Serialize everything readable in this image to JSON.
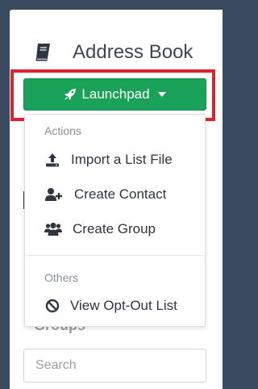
{
  "header": {
    "title": "Address Book",
    "icon": "book-icon"
  },
  "launchpad": {
    "label": "Launchpad",
    "icon": "rocket-icon",
    "color": "#1aa258"
  },
  "dropdown": {
    "section_actions": "Actions",
    "items_actions": [
      {
        "label": "Import a List File",
        "icon": "upload-icon"
      },
      {
        "label": "Create Contact",
        "icon": "add-user-icon"
      },
      {
        "label": "Create Group",
        "icon": "group-icon"
      }
    ],
    "section_others": "Others",
    "items_others": [
      {
        "label": "View Opt-Out List",
        "icon": "ban-icon"
      }
    ]
  },
  "background_section": {
    "partial_heading": "Groups"
  },
  "search": {
    "placeholder": "Search"
  },
  "highlight_color": "#e0222a"
}
